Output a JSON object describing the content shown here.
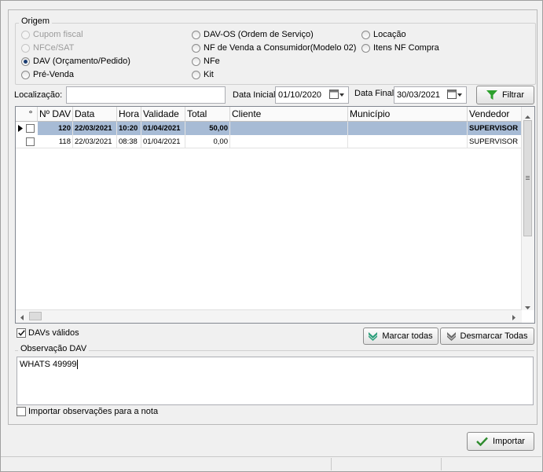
{
  "origem": {
    "title": "Origem",
    "options": [
      {
        "label": "Cupom fiscal",
        "selected": false,
        "disabled": true
      },
      {
        "label": "NFCe/SAT",
        "selected": false,
        "disabled": true
      },
      {
        "label": "DAV (Orçamento/Pedido)",
        "selected": true,
        "disabled": false
      },
      {
        "label": "Pré-Venda",
        "selected": false,
        "disabled": false
      },
      {
        "label": "DAV-OS (Ordem de Serviço)",
        "selected": false,
        "disabled": false
      },
      {
        "label": "NF de Venda a Consumidor(Modelo 02)",
        "selected": false,
        "disabled": false
      },
      {
        "label": "NFe",
        "selected": false,
        "disabled": false
      },
      {
        "label": "Kit",
        "selected": false,
        "disabled": false
      },
      {
        "label": "Locação",
        "selected": false,
        "disabled": false
      },
      {
        "label": "Itens NF Compra",
        "selected": false,
        "disabled": false
      }
    ]
  },
  "filter": {
    "localizacao_label": "Localização:",
    "localizacao_value": "",
    "data_inicial_label": "Data Inicial",
    "data_inicial_value": "01/10/2020",
    "data_final_label": "Data Final",
    "data_final_value": "30/03/2021",
    "filtrar_label": "Filtrar"
  },
  "grid": {
    "columns": [
      "°",
      "Nº DAV",
      "Data",
      "Hora",
      "Validade",
      "Total",
      "Cliente",
      "Município",
      "Vendedor"
    ],
    "rows": [
      {
        "num": "120",
        "data": "22/03/2021",
        "hora": "10:20",
        "validade": "01/04/2021",
        "total": "50,00",
        "cliente": "",
        "municipio": "",
        "vendedor": "SUPERVISOR",
        "selected": true
      },
      {
        "num": "118",
        "data": "22/03/2021",
        "hora": "08:38",
        "validade": "01/04/2021",
        "total": "0,00",
        "cliente": "",
        "municipio": "",
        "vendedor": "SUPERVISOR",
        "selected": false
      }
    ]
  },
  "davs_validos": {
    "label": "DAVs válidos",
    "checked": true
  },
  "marcar_todas_label": "Marcar todas",
  "desmarcar_todas_label": "Desmarcar Todas",
  "observacao": {
    "title": "Observação DAV",
    "value": "WHATS 49999"
  },
  "importar_obs": {
    "label": "Importar observações para a nota",
    "checked": false
  },
  "importar_label": "Importar",
  "colors": {
    "selected_row": "#a7bbd5",
    "filter_icon": "#2ca02c",
    "check_icon": "#2e8b2e"
  }
}
